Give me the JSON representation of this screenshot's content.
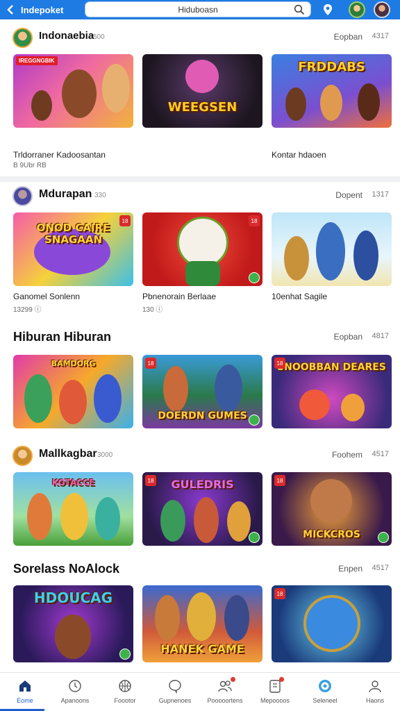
{
  "app": {
    "title": "Indepoket",
    "search_value": "Hiduboasn"
  },
  "sections": [
    {
      "title": "Indonaebia",
      "count": "500",
      "link": "Eopban",
      "num": "4317",
      "cards": [
        {
          "tag": "IREGGNGBIK",
          "art_text": "",
          "caption": "Trldorraner Kadoosantan",
          "sub": "B 9Ubr RB"
        },
        {
          "tag": "",
          "art_text": "WEEGSEN",
          "caption": "",
          "sub": ""
        },
        {
          "tag": "",
          "art_text": "FRDDABS",
          "caption": "Kontar hdaoen",
          "sub": ""
        }
      ]
    },
    {
      "title": "Mdurapan",
      "count": "330",
      "link": "Dopent",
      "num": "1317",
      "cards": [
        {
          "art_text": "ONOD CAIRE SNAGAAN",
          "caption": "Ganomel Sonlenn",
          "sub": "13299 ⓘ"
        },
        {
          "art_text": "",
          "caption": "Pbnenorain Berlaae",
          "sub": "130 ⓘ"
        },
        {
          "art_text": "",
          "caption": "10enhat Sagile",
          "sub": ""
        }
      ]
    },
    {
      "title": "Hiburan Hiburan",
      "count": "",
      "link": "Eopban",
      "num": "4817",
      "cards": [
        {
          "art_text": "BAMDORG",
          "caption": "",
          "sub": ""
        },
        {
          "art_text": "DOERDN GUMES",
          "caption": "",
          "sub": ""
        },
        {
          "art_text": "SNOOBBAN DEARES",
          "caption": "",
          "sub": ""
        }
      ]
    },
    {
      "title": "Mallkagbar",
      "count": "3000",
      "link": "Foohem",
      "num": "4517",
      "cards": [
        {
          "art_text": "KOTACCE",
          "caption": "",
          "sub": ""
        },
        {
          "art_text": "GULEDRIS",
          "caption": "",
          "sub": ""
        },
        {
          "art_text": "MICKCROS",
          "caption": "",
          "sub": ""
        }
      ]
    },
    {
      "title": "Sorelass NoAlock",
      "count": "",
      "link": "Enpen",
      "num": "4517",
      "cards": [
        {
          "art_text": "HDOUCAG",
          "caption": "",
          "sub": ""
        },
        {
          "art_text": "HANEK GAME",
          "caption": "",
          "sub": ""
        },
        {
          "art_text": "",
          "caption": "",
          "sub": ""
        }
      ]
    }
  ],
  "bottom_nav": [
    {
      "label": "Eome",
      "icon": "home-icon",
      "active": true
    },
    {
      "label": "Apanoons",
      "icon": "clock-icon",
      "active": false
    },
    {
      "label": "Foootor",
      "icon": "basketball-icon",
      "active": false
    },
    {
      "label": "Gupnenoes",
      "icon": "chat-icon",
      "active": false
    },
    {
      "label": "Pooooortens",
      "icon": "people-icon",
      "active": false
    },
    {
      "label": "Mepoooos",
      "icon": "tablet-icon",
      "active": false
    },
    {
      "label": "Seleneel",
      "icon": "target-icon",
      "active": false
    },
    {
      "label": "Haons",
      "icon": "profile-icon",
      "active": false
    }
  ],
  "colors": {
    "primary": "#1e7be3",
    "accent": "#1e5fd0",
    "badge_red": "#d92b2b",
    "badge_green": "#3bb24a"
  }
}
